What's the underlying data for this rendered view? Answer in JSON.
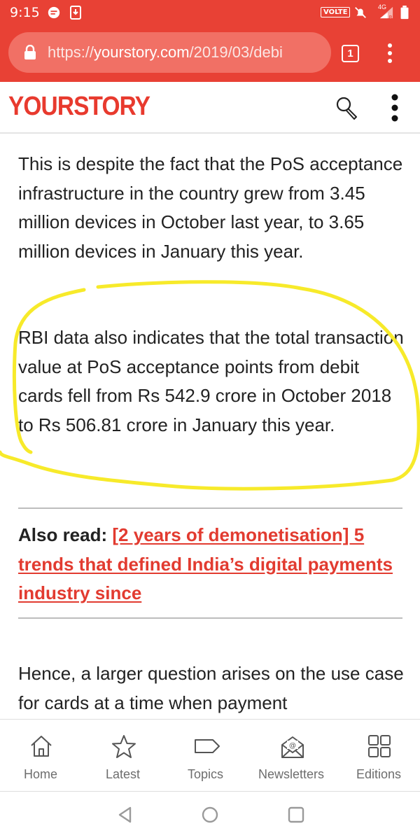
{
  "status_bar": {
    "time": "9:15",
    "volte_label": "VOLTE",
    "network": "4G",
    "icons": [
      "message-icon",
      "download-icon",
      "mute-icon",
      "signal-icon",
      "battery-icon"
    ]
  },
  "browser": {
    "url_scheme": "https://",
    "url_host": "yourstory.com",
    "url_path": "/2019/03/debi",
    "tab_count": "1"
  },
  "site": {
    "logo": "YOURSTORY",
    "brand_color": "#e83a2e"
  },
  "article": {
    "para1": "This is despite the fact that the PoS acceptance infrastructure in the country grew from 3.45 million devices in October last year, to 3.65 million devices in January this year.",
    "para2": "RBI data also indicates that the total transaction value at PoS acceptance points from debit cards fell from Rs 542.9 crore in October 2018 to Rs 506.81 crore in January this year.",
    "also_read_label": "Also read:",
    "also_read_link": "[2 years of demonetisation] 5 trends that defined India’s digital payments industry since",
    "para3": "Hence, a larger question arises on the use case for cards at a time when payment"
  },
  "bottom_nav": {
    "items": [
      {
        "label": "Home",
        "icon": "home-icon"
      },
      {
        "label": "Latest",
        "icon": "star-icon"
      },
      {
        "label": "Topics",
        "icon": "tag-icon"
      },
      {
        "label": "Newsletters",
        "icon": "mail-icon"
      },
      {
        "label": "Editions",
        "icon": "grid-icon"
      }
    ]
  },
  "colors": {
    "accent": "#e84135",
    "highlight": "#f7ea2a",
    "link": "#e23b30"
  }
}
